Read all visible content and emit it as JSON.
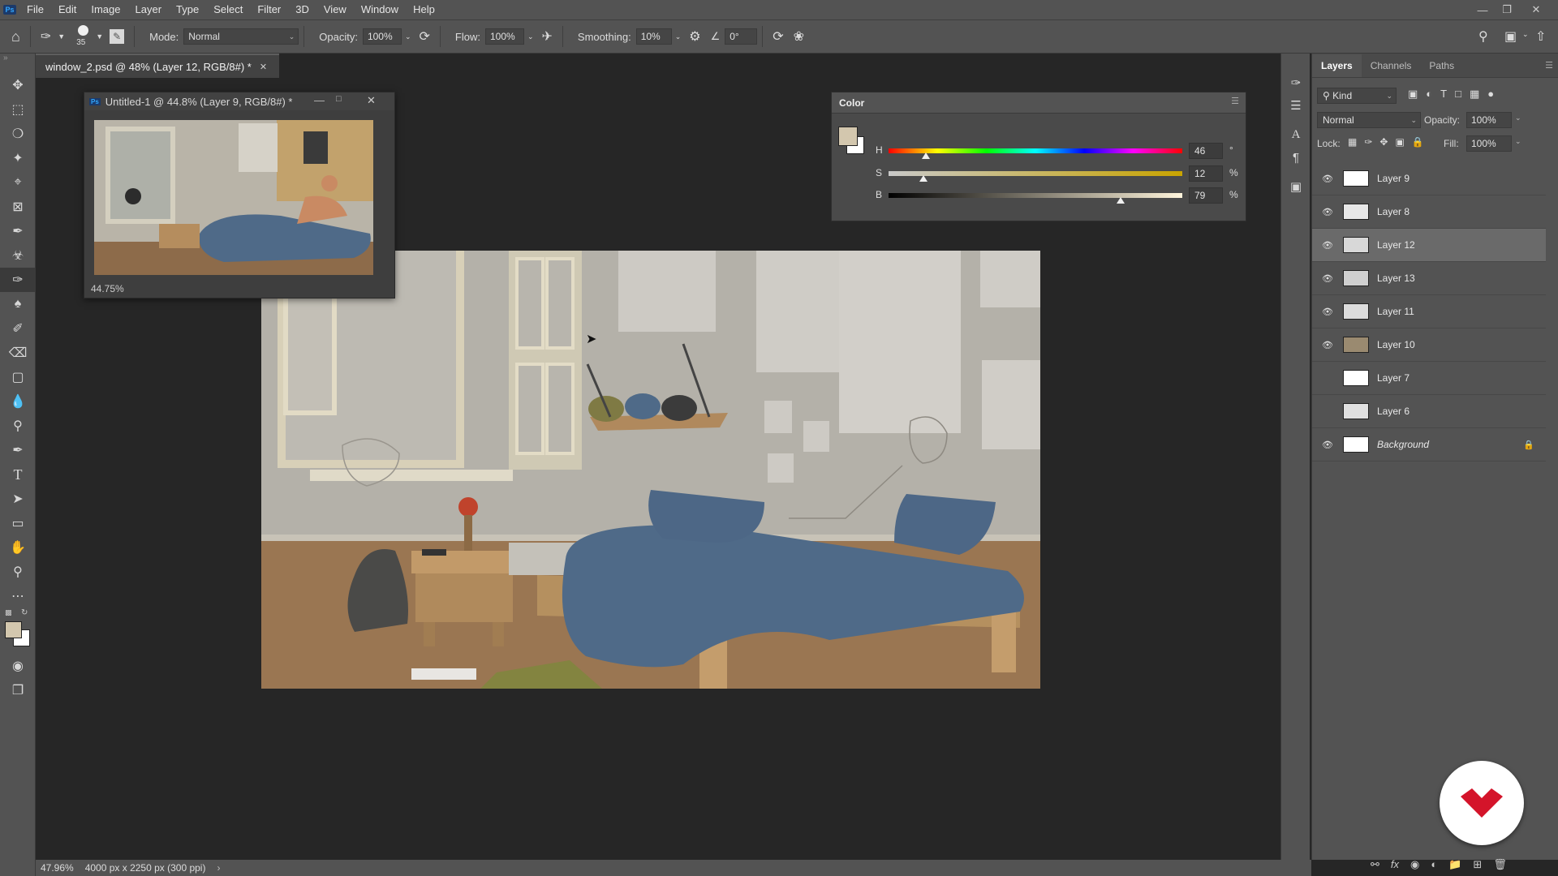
{
  "menu": {
    "items": [
      "File",
      "Edit",
      "Image",
      "Layer",
      "Type",
      "Select",
      "Filter",
      "3D",
      "View",
      "Window",
      "Help"
    ],
    "logo_text": "Ps"
  },
  "options": {
    "brush_size": "35",
    "mode_label": "Mode:",
    "mode_value": "Normal",
    "opacity_label": "Opacity:",
    "opacity_value": "100%",
    "flow_label": "Flow:",
    "flow_value": "100%",
    "smoothing_label": "Smoothing:",
    "smoothing_value": "10%",
    "angle_value": "0°"
  },
  "document": {
    "tab_title": "window_2.psd @ 48% (Layer 12, RGB/8#) *"
  },
  "float_window": {
    "title": "Untitled-1 @ 44.8% (Layer 9, RGB/8#) *",
    "zoom": "44.75%",
    "icon_text": "Ps"
  },
  "color_panel": {
    "title": "Color",
    "foreground": "#d3c7ae",
    "background": "#ffffff",
    "h": {
      "label": "H",
      "value": "46",
      "unit": "°",
      "level": 0.127
    },
    "s": {
      "label": "S",
      "value": "12",
      "unit": "%",
      "level": 0.12
    },
    "b": {
      "label": "B",
      "value": "79",
      "unit": "%",
      "level": 0.79
    }
  },
  "layers_panel": {
    "tabs": [
      "Layers",
      "Channels",
      "Paths"
    ],
    "filter_value": "Kind",
    "blend_mode": "Normal",
    "opacity_label": "Opacity:",
    "opacity_value": "100%",
    "lock_label": "Lock:",
    "fill_label": "Fill:",
    "fill_value": "100%",
    "layers": [
      {
        "name": "Layer 9",
        "visible": true
      },
      {
        "name": "Layer 8",
        "visible": true
      },
      {
        "name": "Layer 12",
        "visible": true,
        "selected": true
      },
      {
        "name": "Layer 13",
        "visible": true
      },
      {
        "name": "Layer 11",
        "visible": true
      },
      {
        "name": "Layer 10",
        "visible": true
      },
      {
        "name": "Layer 7",
        "visible": false
      },
      {
        "name": "Layer 6",
        "visible": false
      },
      {
        "name": "Background",
        "visible": true,
        "locked": true
      }
    ]
  },
  "status": {
    "zoom": "47.96%",
    "doc_info": "4000 px x 2250 px (300 ppi)"
  },
  "colors": {
    "ui_panel": "#535353",
    "workspace": "#262626",
    "blanket_blue": "#4f6a88",
    "wall": "#b1aea5",
    "floor": "#9a7652",
    "badge_red": "#d4142a"
  }
}
